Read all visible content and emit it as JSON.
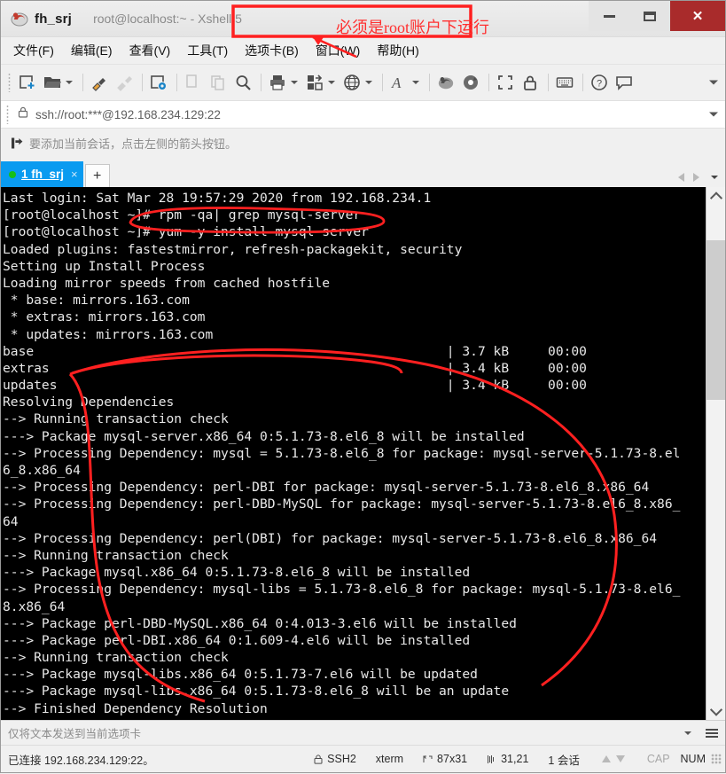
{
  "window": {
    "app_name": "fh_srj",
    "title": "root@localhost:~ - Xshell 5",
    "minimize_label": "Minimize",
    "maximize_label": "Maximize",
    "close_label": "Close"
  },
  "annotations": {
    "note_text": "必须是root账户下运行",
    "color": "#ff3030"
  },
  "menu": {
    "items": [
      {
        "label": "文件(F)"
      },
      {
        "label": "编辑(E)"
      },
      {
        "label": "查看(V)"
      },
      {
        "label": "工具(T)"
      },
      {
        "label": "选项卡(B)"
      },
      {
        "label": "窗口(W)"
      },
      {
        "label": "帮助(H)"
      }
    ]
  },
  "toolbar": {
    "buttons": [
      {
        "name": "new-session-icon"
      },
      {
        "name": "open-folder-icon"
      },
      {
        "name": "connect-icon"
      },
      {
        "name": "disconnect-icon"
      },
      {
        "name": "session-properties-icon"
      },
      {
        "name": "copy-icon"
      },
      {
        "name": "paste-icon"
      },
      {
        "name": "find-icon"
      },
      {
        "name": "print-icon"
      },
      {
        "name": "file-transfer-icon"
      },
      {
        "name": "globe-icon"
      },
      {
        "name": "font-icon"
      },
      {
        "name": "xshell-icon"
      },
      {
        "name": "xftp-icon"
      },
      {
        "name": "fullscreen-icon"
      },
      {
        "name": "lock-icon"
      },
      {
        "name": "keyboard-icon"
      },
      {
        "name": "help-icon"
      },
      {
        "name": "chat-icon"
      }
    ],
    "overflow_label": "More"
  },
  "address_bar": {
    "value": "ssh://root:***@192.168.234.129:22",
    "lock_icon": "lock-icon"
  },
  "hint_bar": {
    "text": "要添加当前会话，点击左侧的箭头按钮。",
    "icon": "add-session-icon"
  },
  "tabs": {
    "items": [
      {
        "label": "1 fh_srj",
        "status": "connected",
        "close_label": "×"
      }
    ],
    "new_tab_label": "+",
    "nav_prev": "prev-tab",
    "nav_next": "next-tab"
  },
  "terminal": {
    "lines": [
      "Last login: Sat Mar 28 19:57:29 2020 from 192.168.234.1",
      "[root@localhost ~]# rpm -qa| grep mysql-server",
      "[root@localhost ~]# yum -y install mysql-server",
      "Loaded plugins: fastestmirror, refresh-packagekit, security",
      "Setting up Install Process",
      "Loading mirror speeds from cached hostfile",
      " * base: mirrors.163.com",
      " * extras: mirrors.163.com",
      " * updates: mirrors.163.com",
      "base                                                     | 3.7 kB     00:00",
      "extras                                                   | 3.4 kB     00:00",
      "updates                                                  | 3.4 kB     00:00",
      "Resolving Dependencies",
      "--> Running transaction check",
      "---> Package mysql-server.x86_64 0:5.1.73-8.el6_8 will be installed",
      "--> Processing Dependency: mysql = 5.1.73-8.el6_8 for package: mysql-server-5.1.73-8.el",
      "6_8.x86_64",
      "--> Processing Dependency: perl-DBI for package: mysql-server-5.1.73-8.el6_8.x86_64",
      "--> Processing Dependency: perl-DBD-MySQL for package: mysql-server-5.1.73-8.el6_8.x86_",
      "64",
      "--> Processing Dependency: perl(DBI) for package: mysql-server-5.1.73-8.el6_8.x86_64",
      "--> Running transaction check",
      "---> Package mysql.x86_64 0:5.1.73-8.el6_8 will be installed",
      "--> Processing Dependency: mysql-libs = 5.1.73-8.el6_8 for package: mysql-5.1.73-8.el6_",
      "8.x86_64",
      "---> Package perl-DBD-MySQL.x86_64 0:4.013-3.el6 will be installed",
      "---> Package perl-DBI.x86_64 0:1.609-4.el6 will be installed",
      "--> Running transaction check",
      "---> Package mysql-libs.x86_64 0:5.1.73-7.el6 will be updated",
      "---> Package mysql-libs.x86_64 0:5.1.73-8.el6_8 will be an update",
      "--> Finished Dependency Resolution"
    ]
  },
  "send_bar": {
    "text": "仅将文本发送到当前选项卡"
  },
  "status_bar": {
    "connection": "已连接 192.168.234.129:22。",
    "protocol": "SSH2",
    "terminal_type": "xterm",
    "size": "87x31",
    "cursor": "31,21",
    "sessions": "1 会话",
    "cap": "CAP",
    "num": "NUM"
  }
}
